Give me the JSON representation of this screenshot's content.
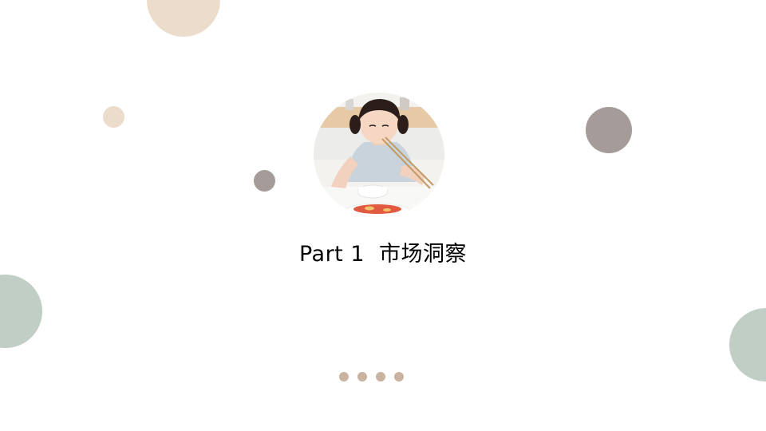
{
  "slide": {
    "title_part": "Part 1",
    "title_text": "市场洞察",
    "photo_subject": "girl-eating-with-chopsticks",
    "pager_count": 4
  },
  "colors": {
    "beige": "#ecdccb",
    "grey": "#a59b98",
    "sage": "#c1cec5",
    "pager_dot": "#c9b3a1",
    "title": "#000000"
  }
}
